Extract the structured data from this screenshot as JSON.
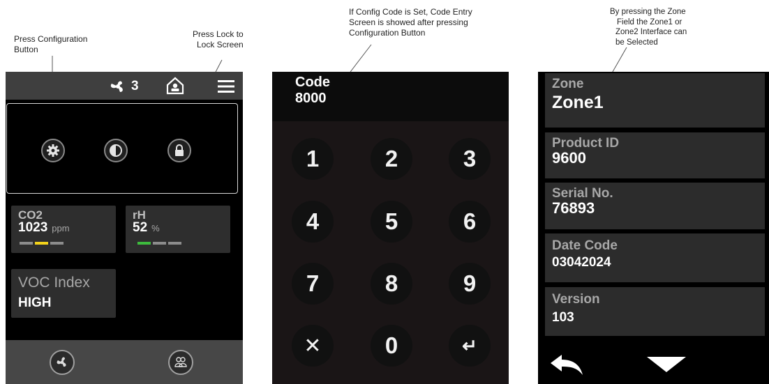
{
  "annotations": {
    "config": [
      "Press Configuration",
      "Button"
    ],
    "lock": [
      "Press Lock to",
      "Lock Screen"
    ],
    "code": [
      "If Config Code is Set, Code Entry",
      "Screen is showed after pressing",
      "Configuration Button"
    ],
    "zone": [
      "By pressing the Zone",
      "Field the Zone1 or",
      "Zone2 Interface can",
      "be Selected"
    ]
  },
  "screen1": {
    "fan_speed": "3",
    "icons": [
      "fan-icon",
      "house-person-icon",
      "hamburger-menu-icon",
      "gear-icon",
      "contrast-icon",
      "lock-icon",
      "fan-mode-icon",
      "zones-icon"
    ],
    "co2": {
      "label": "CO2",
      "value": "1023",
      "unit": "ppm",
      "bar_colors": [
        "#8c8c8c",
        "#f2d21b",
        "#8c8c8c"
      ]
    },
    "rh": {
      "label": "rH",
      "value": "52",
      "unit": "%",
      "bar_colors": [
        "#3dbb3d",
        "#8c8c8c",
        "#8c8c8c"
      ]
    },
    "voc": {
      "label": "VOC Index",
      "value": "HIGH"
    }
  },
  "screen2": {
    "code_label": "Code",
    "code_value": "8000",
    "keys": [
      "1",
      "2",
      "3",
      "4",
      "5",
      "6",
      "7",
      "8",
      "9",
      "✕",
      "0",
      "↵"
    ]
  },
  "screen3": {
    "fields": [
      {
        "label": "Zone",
        "value": "Zone1"
      },
      {
        "label": "Product ID",
        "value": "9600"
      },
      {
        "label": "Serial No.",
        "value": "76893"
      },
      {
        "label": "Date Code",
        "value": "03042024"
      },
      {
        "label": "Version",
        "value": "103"
      }
    ],
    "icons": [
      "back-arrow-icon",
      "down-arrow-icon"
    ]
  }
}
